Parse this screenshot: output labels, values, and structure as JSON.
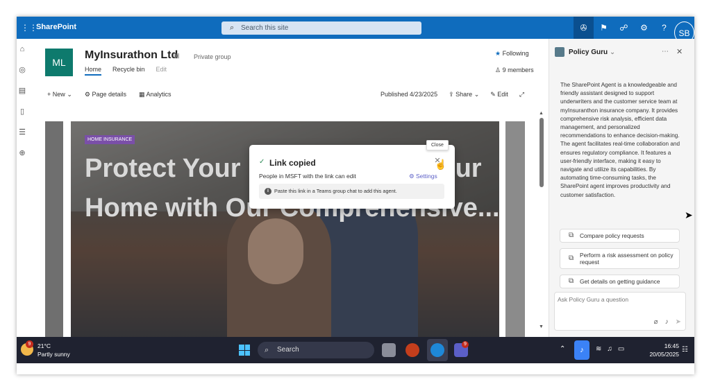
{
  "topbar": {
    "app_name": "SharePoint",
    "search_placeholder": "Search this site",
    "icons": [
      "copilot-icon",
      "megaphone-icon",
      "people-icon",
      "settings-icon",
      "help-icon"
    ],
    "avatar_initials": "SB"
  },
  "site": {
    "logo_initials": "ML",
    "title": "MyInsurathon Ltd",
    "privacy": "Private group",
    "nav": [
      "Home",
      "Recycle bin",
      "Edit"
    ],
    "following_label": "Following",
    "members_label": "9 members"
  },
  "commandbar": {
    "new_label": "New",
    "page_details_label": "Page details",
    "analytics_label": "Analytics",
    "published_label": "Published 4/23/2025",
    "share_label": "Share",
    "edit_label": "Edit"
  },
  "hero": {
    "tag": "HOME INSURANCE",
    "headline": "Protect Your Home Secure Your Home with Our Comprehensive..."
  },
  "dialog": {
    "title": "Link copied",
    "subtitle": "People in MSFT with the link can edit",
    "settings_label": "Settings",
    "info_text": "Paste this link in a Teams group chat to add this agent.",
    "close_tooltip": "Close"
  },
  "panel": {
    "title": "Policy Guru",
    "description": "The SharePoint Agent is a knowledgeable and friendly assistant designed to support underwriters and the customer service team at myInsuranthon insurance company. It provides comprehensive risk analysis, efficient data management, and personalized recommendations to enhance decision-making. The agent facilitates real-time collaboration and ensures regulatory compliance. It features a user-friendly interface, making it easy to navigate and utilize its capabilities. By automating time-consuming tasks, the SharePoint agent improves productivity and customer satisfaction.",
    "prompts": [
      "Compare policy requests",
      "Perform a risk assessment on policy request",
      "Get details on getting guidance"
    ],
    "ask_placeholder": "Ask Policy Guru a question"
  },
  "taskbar": {
    "weather_badge": "9",
    "temperature": "21°C",
    "condition": "Partly sunny",
    "search_label": "Search",
    "teams_badge": "9",
    "time": "16:45",
    "date": "20/05/2025"
  }
}
